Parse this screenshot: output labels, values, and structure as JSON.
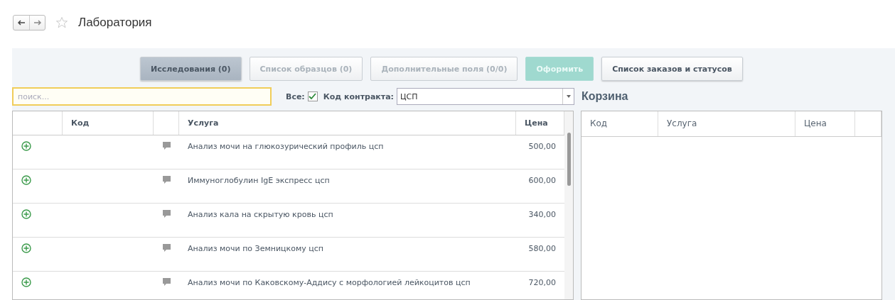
{
  "header": {
    "title": "Лаборатория",
    "favorite": false
  },
  "toolbar": [
    {
      "label": "Исследования (0)",
      "kind": "tab",
      "selected": true,
      "disabled": false
    },
    {
      "label": "Список образцов (0)",
      "kind": "tab",
      "selected": false,
      "disabled": true
    },
    {
      "label": "Дополнительные поля (0/0)",
      "kind": "tab",
      "selected": false,
      "disabled": true
    },
    {
      "label": "Оформить",
      "kind": "primary",
      "selected": false,
      "disabled": true
    },
    {
      "label": "Список заказов и статусов",
      "kind": "plain",
      "selected": false,
      "disabled": false
    }
  ],
  "search": {
    "placeholder": "поиск..."
  },
  "filter": {
    "all_label": "Все:",
    "all_checked": true,
    "contract_label": "Код контракта:",
    "contract_value": "ЦСП"
  },
  "services_table": {
    "columns": [
      "Код",
      "Услуга",
      "Цена"
    ],
    "rows": [
      {
        "service": "Анализ мочи на глюкозурический профиль цсп",
        "price": "500,00"
      },
      {
        "service": "Иммуноглобулин IgE экспресс цсп",
        "price": "600,00"
      },
      {
        "service": "Анализ кала на скрытую кровь цсп",
        "price": "340,00"
      },
      {
        "service": "Анализ мочи по Земницкому цсп",
        "price": "580,00"
      },
      {
        "service": "Анализ мочи по Каковскому-Аддису с морфологией лейкоцитов цсп",
        "price": "720,00"
      }
    ]
  },
  "cart": {
    "title": "Корзина",
    "columns": [
      "Код",
      "Услуга",
      "Цена"
    ]
  }
}
